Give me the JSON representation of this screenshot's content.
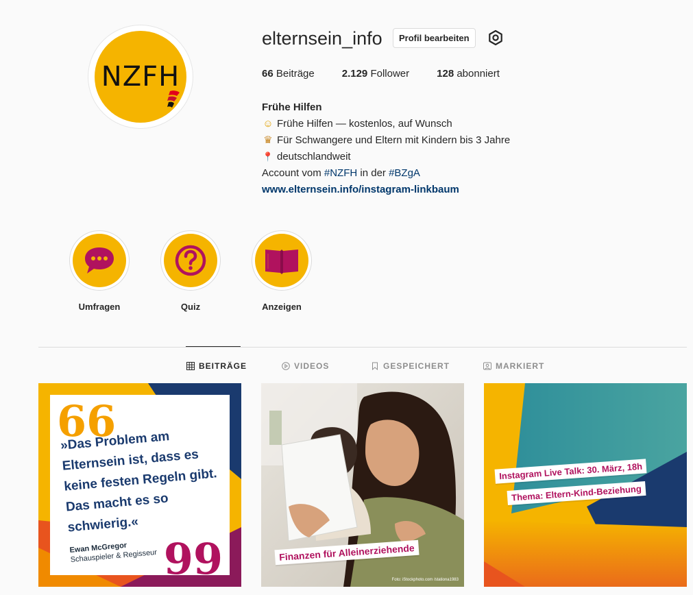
{
  "profile": {
    "avatar_text": "NZFH",
    "username": "elternsein_info",
    "edit_button": "Profil bearbeiten",
    "stats": {
      "posts_count": "66",
      "posts_label": "Beiträge",
      "followers_count": "2.129",
      "followers_label": "Follower",
      "following_count": "128",
      "following_label": "abonniert"
    },
    "bio": {
      "name": "Frühe Hilfen",
      "line1": "Frühe Hilfen — kostenlos, auf Wunsch",
      "line1_emoji": "☺",
      "line2": "Für Schwangere und Eltern mit Kindern bis 3 Jahre",
      "line2_emoji": "♛",
      "line3": "deutschlandweit",
      "line3_emoji": "📍",
      "line4_prefix": "Account vom ",
      "line4_tag1": "#NZFH",
      "line4_middle": " in der ",
      "line4_tag2": "#BZgA",
      "link": "www.elternsein.info/instagram-linkbaum"
    }
  },
  "highlights": [
    {
      "label": "Umfragen",
      "icon": "speech-bubble-icon"
    },
    {
      "label": "Quiz",
      "icon": "question-icon"
    },
    {
      "label": "Anzeigen",
      "icon": "book-icon"
    }
  ],
  "tabs": [
    {
      "label": "BEITRÄGE",
      "icon": "grid-icon",
      "active": true
    },
    {
      "label": "VIDEOS",
      "icon": "play-icon",
      "active": false
    },
    {
      "label": "GESPEICHERT",
      "icon": "bookmark-icon",
      "active": false
    },
    {
      "label": "MARKIERT",
      "icon": "tag-person-icon",
      "active": false
    }
  ],
  "posts": {
    "post1": {
      "quote_open": "66",
      "quote_close": "99",
      "quote": "»Das Problem am Elternsein ist, dass es keine festen Regeln gibt. Das macht es so schwierig.«",
      "author": "Ewan McGregor",
      "author_role": "Schauspieler & Regisseur"
    },
    "post2": {
      "banner": "Finanzen für Alleinerziehende",
      "credit": "Foto: iStockphoto.com /stationa1983"
    },
    "post3": {
      "banner1": "Instagram Live Talk: 30. März, 18h",
      "banner2": "Thema: Eltern-Kind-Beziehung"
    }
  },
  "colors": {
    "brand_yellow": "#f5b400",
    "brand_magenta": "#b0125e",
    "link_blue": "#00376b",
    "navy": "#1a3a6e"
  }
}
